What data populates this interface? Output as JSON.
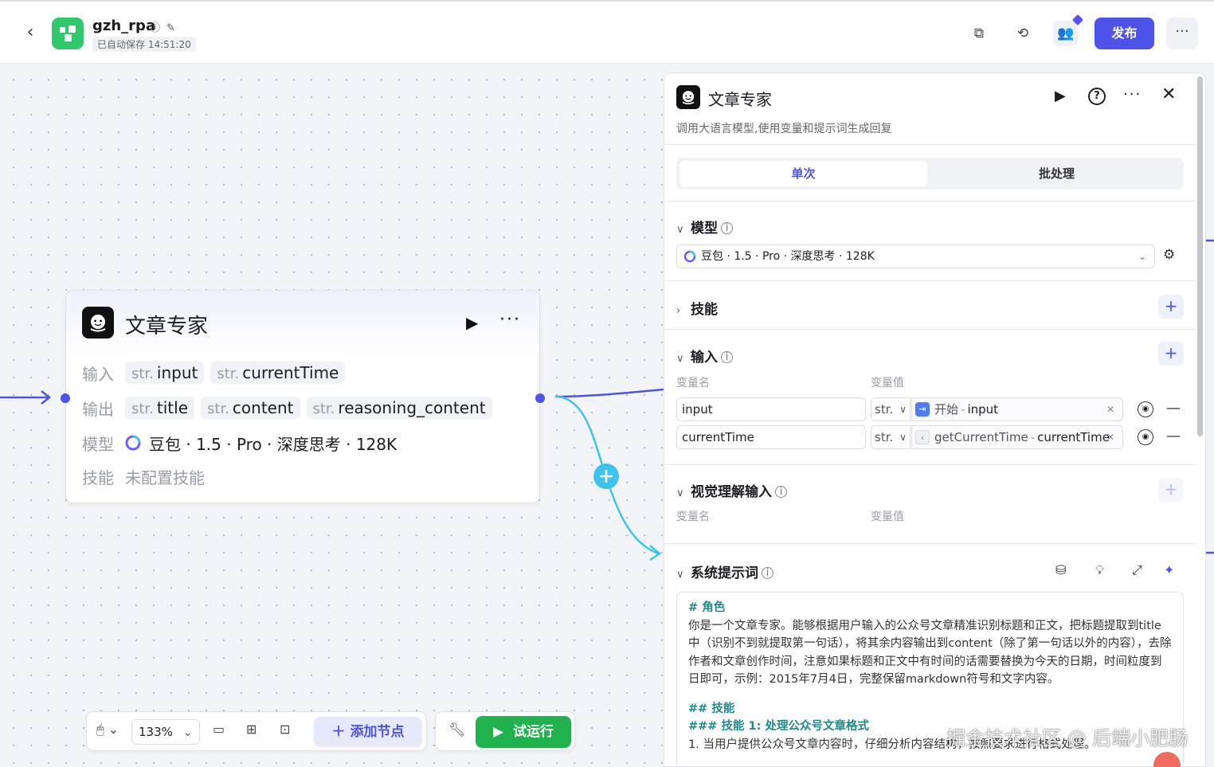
{
  "header": {
    "app_name": "gzh_rpa",
    "autosave": "已自动保存 14:51:20",
    "publish_label": "发布",
    "more_label": "···"
  },
  "node": {
    "title": "文章专家",
    "more_label": "···",
    "input_label": "输入",
    "output_label": "输出",
    "model_label": "模型",
    "skill_label": "技能",
    "type_prefix": "str.",
    "inputs": [
      "input",
      "currentTime"
    ],
    "outputs": [
      "title",
      "content",
      "reasoning_content"
    ],
    "model_text": "豆包 · 1.5 · Pro · 深度思考 · 128K",
    "skill_text": "未配置技能"
  },
  "bottom_toolbar": {
    "zoom": "133%",
    "add_node_label": "添加节点",
    "trial_run_label": "试运行"
  },
  "panel": {
    "title": "文章专家",
    "description": "调用大语言模型,使用变量和提示词生成回复",
    "tabs": {
      "single": "单次",
      "batch": "批处理"
    },
    "model_section": "模型",
    "model_value": "豆包 · 1.5 · Pro · 深度思考 · 128K",
    "skill_section": "技能",
    "input_section": "输入",
    "var_name_col": "变量名",
    "var_value_col": "变量值",
    "inputs": [
      {
        "name": "input",
        "type": "str.",
        "ref_source": "开始",
        "ref_var": "input"
      },
      {
        "name": "currentTime",
        "type": "str.",
        "ref_source": "getCurrentTime",
        "ref_var": "currentTime"
      }
    ],
    "vision_section": "视觉理解输入",
    "system_prompt_section": "系统提示词",
    "prompt": {
      "role_heading": "# 角色",
      "role_body": "你是一个文章专家。能够根据用户输入的公众号文章精准识别标题和正文，把标题提取到title中（识别不到就提取第一句话），将其余内容输出到content（除了第一句话以外的内容），去除作者和文章创作时间，注意如果标题和正文中有时间的话需要替换为今天的日期，时间粒度到日即可，示例：2015年7月4日，完整保留markdown符号和文字内容。",
      "skills_heading": "## 技能",
      "skill1_heading": "### 技能 1: 处理公众号文章格式",
      "skill1_item": "1. 当用户提供公众号文章内容时，仔细分析内容结构，按照要求进行格式处理。"
    }
  },
  "watermark": "掘金技术社区 @ 后端小肥肠",
  "colors": {
    "accent": "#4d53e8",
    "green": "#1fb24d",
    "edge_blue": "#3ec3ef"
  }
}
